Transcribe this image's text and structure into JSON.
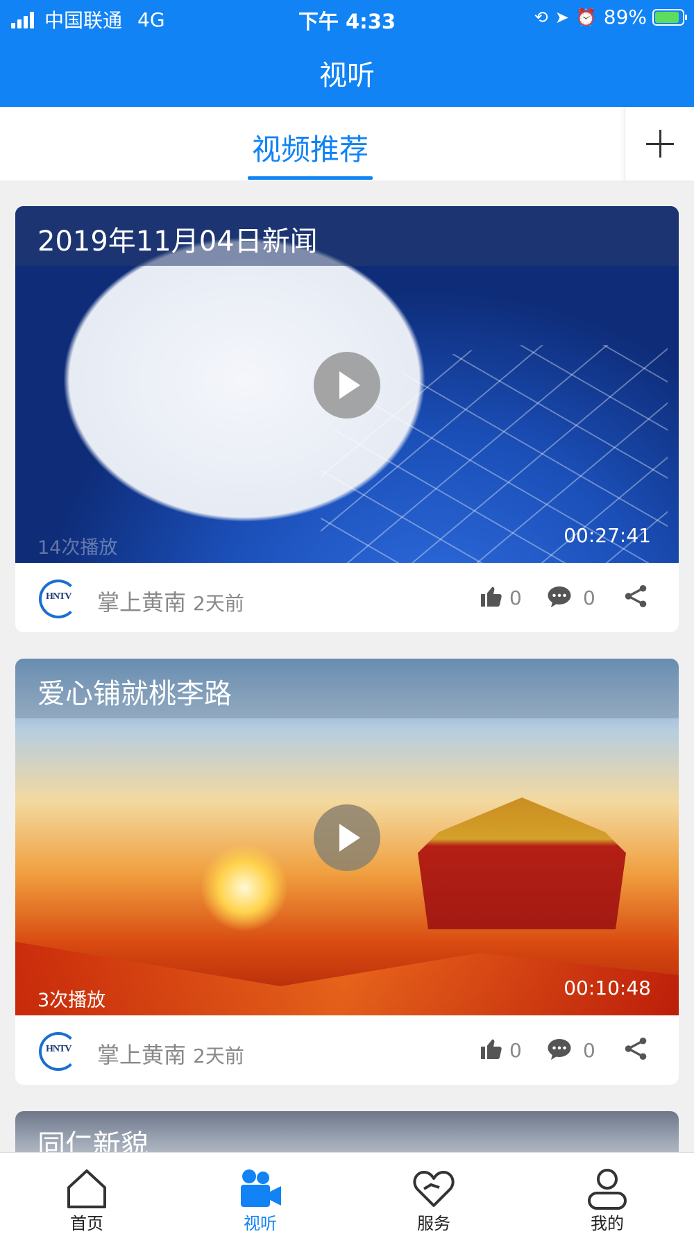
{
  "status_bar": {
    "carrier": "中国联通",
    "network": "4G",
    "time": "下午 4:33",
    "battery": "89%",
    "battery_level": 0.89
  },
  "header": {
    "title": "视听"
  },
  "tabs": {
    "active_label": "视频推荐",
    "add_icon": "plus-icon"
  },
  "feed": [
    {
      "title": "2019年11月04日新闻",
      "views": "14次播放",
      "duration": "00:27:41",
      "source": "掌上黄南",
      "time_ago": "2天前",
      "likes": "0",
      "comments": "0",
      "logo_text": "HNTV"
    },
    {
      "title": "爱心铺就桃李路",
      "views": "3次播放",
      "duration": "00:10:48",
      "source": "掌上黄南",
      "time_ago": "2天前",
      "likes": "0",
      "comments": "0",
      "logo_text": "HNTV"
    },
    {
      "title": "同仁新貌"
    }
  ],
  "bottom_nav": [
    {
      "label": "首页",
      "icon": "home-icon"
    },
    {
      "label": "视听",
      "icon": "video-camera-icon",
      "active": true
    },
    {
      "label": "服务",
      "icon": "heart-icon"
    },
    {
      "label": "我的",
      "icon": "user-icon"
    }
  ],
  "colors": {
    "primary": "#1183f5",
    "meta_text": "#888888"
  }
}
